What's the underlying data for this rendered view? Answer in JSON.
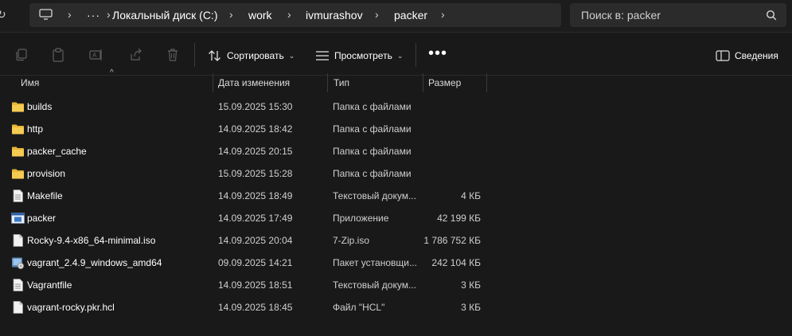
{
  "address": {
    "overflow_label": "···",
    "crumbs": [
      "Локальный диск (C:)",
      "work",
      "ivmurashov",
      "packer"
    ]
  },
  "search": {
    "placeholder": "Поиск в: packer"
  },
  "toolbar": {
    "sort_label": "Сортировать",
    "view_label": "Просмотреть",
    "more_label": "•••",
    "details_label": "Сведения"
  },
  "columns": {
    "name": "Имя",
    "date": "Дата изменения",
    "type": "Тип",
    "size": "Размер"
  },
  "files": [
    {
      "name": "builds",
      "date": "15.09.2025 15:30",
      "type": "Папка с файлами",
      "size": "",
      "icon": "folder-icon"
    },
    {
      "name": "http",
      "date": "14.09.2025 18:42",
      "type": "Папка с файлами",
      "size": "",
      "icon": "folder-icon"
    },
    {
      "name": "packer_cache",
      "date": "14.09.2025 20:15",
      "type": "Папка с файлами",
      "size": "",
      "icon": "folder-icon"
    },
    {
      "name": "provision",
      "date": "15.09.2025 15:28",
      "type": "Папка с файлами",
      "size": "",
      "icon": "folder-icon"
    },
    {
      "name": "Makefile",
      "date": "14.09.2025 18:49",
      "type": "Текстовый докум...",
      "size": "4 КБ",
      "icon": "text-file-icon"
    },
    {
      "name": "packer",
      "date": "14.09.2025 17:49",
      "type": "Приложение",
      "size": "42 199 КБ",
      "icon": "application-icon"
    },
    {
      "name": "Rocky-9.4-x86_64-minimal.iso",
      "date": "14.09.2025 20:04",
      "type": "7-Zip.iso",
      "size": "1 786 752 КБ",
      "icon": "blank-file-icon"
    },
    {
      "name": "vagrant_2.4.9_windows_amd64",
      "date": "09.09.2025 14:21",
      "type": "Пакет установщи...",
      "size": "242 104 КБ",
      "icon": "installer-icon"
    },
    {
      "name": "Vagrantfile",
      "date": "14.09.2025 18:51",
      "type": "Текстовый докум...",
      "size": "3 КБ",
      "icon": "text-file-icon"
    },
    {
      "name": "vagrant-rocky.pkr.hcl",
      "date": "14.09.2025 18:45",
      "type": "Файл \"HCL\"",
      "size": "3 КБ",
      "icon": "blank-file-icon"
    }
  ],
  "colors": {
    "background": "#191919",
    "folder": "#f4c545",
    "accent": "#4cc2ff"
  }
}
